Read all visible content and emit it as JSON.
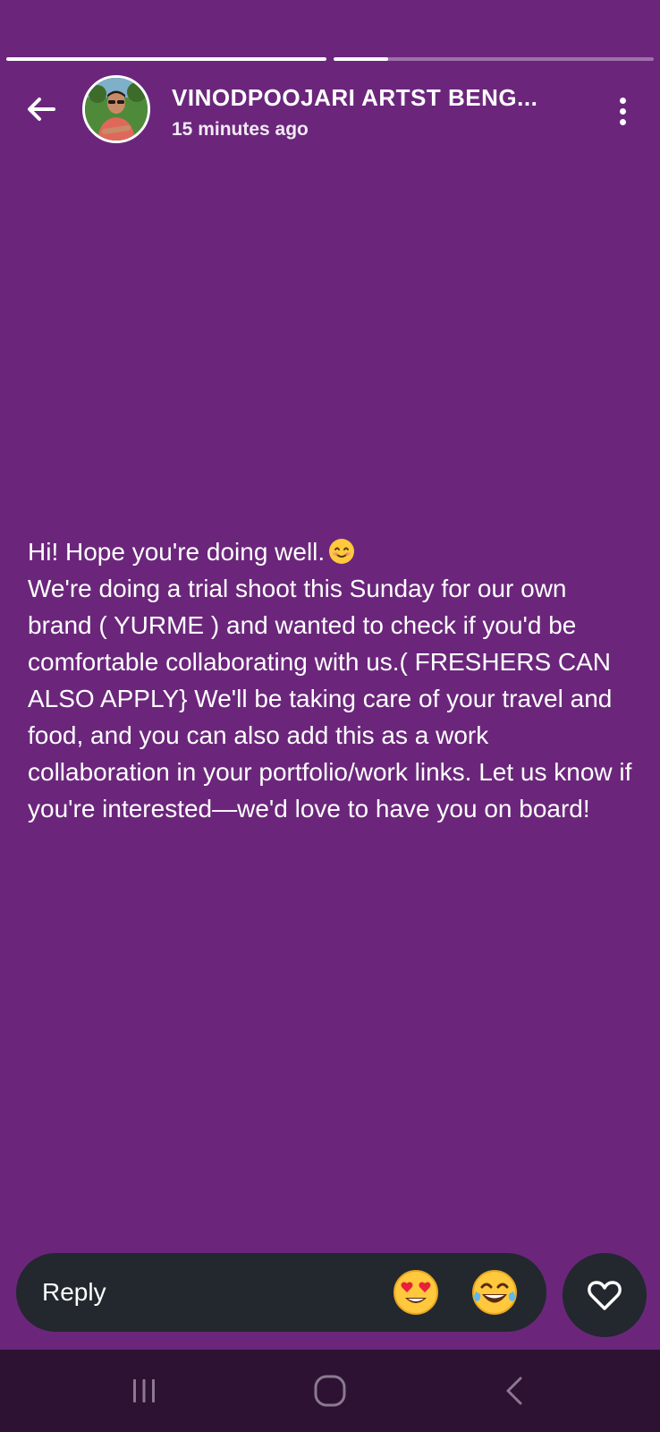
{
  "header": {
    "username": "VINODPOOJARI ARTST BENG...",
    "timestamp": "15 minutes ago"
  },
  "progress": [
    {
      "fill": 1.0
    },
    {
      "fill": 0.17
    }
  ],
  "message": {
    "line1": "Hi! Hope you're doing well.",
    "body": "We're doing a trial shoot this Sunday for our own brand ( YURME ) and wanted to check if you'd be comfortable collaborating with us.( FRESHERS CAN ALSO APPLY} We'll be taking care of your travel and food, and you can also add this as a work collaboration in your portfolio/work links. Let us know if you're interested—we'd love to have you on board!"
  },
  "reply": {
    "label": "Reply",
    "quick_reactions": [
      "heart-eyes-emoji",
      "tears-of-joy-emoji"
    ]
  },
  "colors": {
    "background": "#6b267b",
    "reply_bar": "#22282d",
    "nav_bar": "#2e1233"
  },
  "icons": {
    "back": "back-arrow-icon",
    "more": "more-vertical-icon",
    "like": "heart-outline-icon",
    "nav_recents": "recents-icon",
    "nav_home": "home-icon",
    "nav_back": "nav-back-icon"
  }
}
